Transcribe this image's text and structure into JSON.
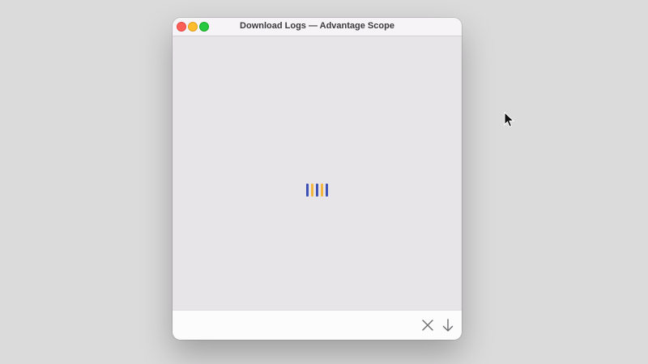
{
  "window": {
    "title": "Download Logs — Advantage Scope"
  },
  "titlebar": {
    "buttons": [
      {
        "name": "close",
        "color": "#fe5f57"
      },
      {
        "name": "minimize",
        "color": "#febc2e"
      },
      {
        "name": "zoom",
        "color": "#28c840"
      }
    ]
  },
  "loader": {
    "icon": "loading-bars-icon",
    "bar_colors": [
      "#3f51b5",
      "#f2b63f",
      "#3f51b5",
      "#f2b63f",
      "#3f51b5"
    ]
  },
  "footer": {
    "buttons": [
      {
        "name": "close-button",
        "icon": "x-icon"
      },
      {
        "name": "download-button",
        "icon": "arrow-down-icon"
      }
    ]
  },
  "colors": {
    "desktop": "#dcdbdc",
    "window_content": "#e7e5e8",
    "footer": "#fdfcfd",
    "icon": "#6b6a6d"
  }
}
